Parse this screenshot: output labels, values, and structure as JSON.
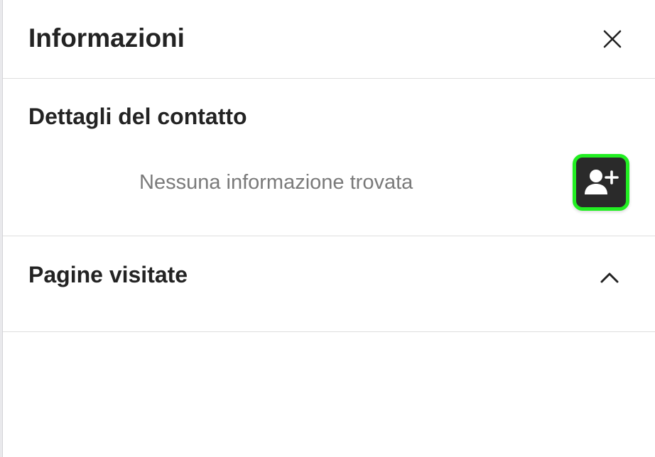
{
  "panel": {
    "title": "Informazioni"
  },
  "contact_details": {
    "title": "Dettagli del contatto",
    "empty_message": "Nessuna informazione trovata"
  },
  "visited_pages": {
    "title": "Pagine visitate"
  },
  "icons": {
    "close": "close-icon",
    "add_contact": "person-add-icon",
    "collapse": "chevron-up-icon"
  },
  "colors": {
    "highlight": "#22ef22",
    "button_bg": "#2a2a2a",
    "muted_text": "#7a7a7a"
  }
}
